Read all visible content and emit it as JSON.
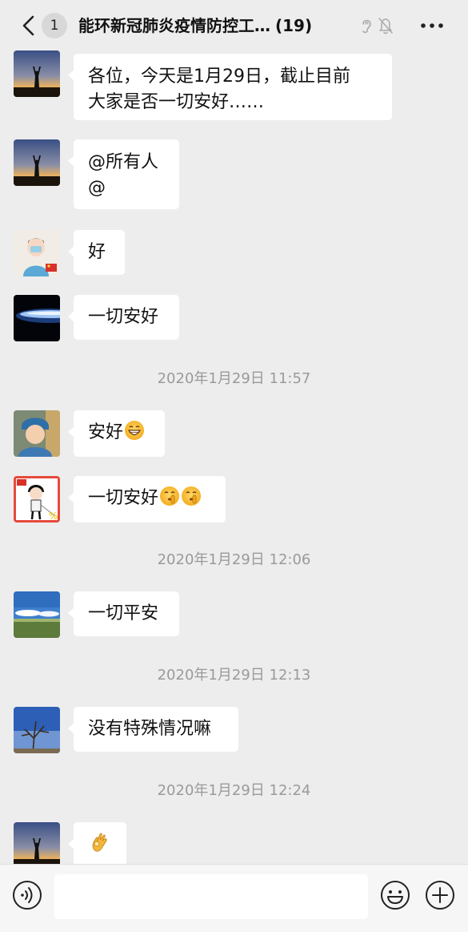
{
  "header": {
    "back_count": "1",
    "title": "能环新冠肺炎疫情防控工…",
    "member_count": "(19)",
    "icons": [
      "back-arrow-icon",
      "ear-icon",
      "bell-muted-icon",
      "more-icon"
    ]
  },
  "messages": [
    {
      "avatar": "sunset-silhouette-avatar",
      "lines": [
        "各位，今天是1月29日，截止目前",
        "大家是否一切安好……"
      ]
    },
    {
      "avatar": "sunset-silhouette-avatar",
      "lines": [
        "@所有人",
        "@"
      ]
    },
    {
      "avatar": "cartoon-doctor-avatar",
      "lines": [
        "好"
      ]
    },
    {
      "avatar": "earth-from-space-avatar",
      "lines": [
        "一切安好"
      ]
    },
    {
      "timestamp": "2020年1月29日 11:57"
    },
    {
      "avatar": "child-avatar",
      "lines": [
        "安好"
      ],
      "emoji": [
        "grin-emoji"
      ]
    },
    {
      "avatar": "cartoon-boy-avatar",
      "lines": [
        "一切安好"
      ],
      "emoji": [
        "shush-emoji",
        "shush-emoji"
      ]
    },
    {
      "timestamp": "2020年1月29日 12:06"
    },
    {
      "avatar": "sky-grassland-avatar",
      "lines": [
        "一切平安"
      ]
    },
    {
      "timestamp": "2020年1月29日 12:13"
    },
    {
      "avatar": "tree-sky-avatar",
      "lines": [
        "没有特殊情况嘛"
      ]
    },
    {
      "timestamp": "2020年1月29日 12:24"
    },
    {
      "avatar": "sunset-silhouette-avatar",
      "lines": [
        ""
      ],
      "emoji": [
        "ok-hand-emoji"
      ]
    }
  ],
  "input_bar": {
    "placeholder": "",
    "icons": [
      "voice-icon",
      "emoji-icon",
      "plus-icon"
    ]
  },
  "colors": {
    "background": "#ededed",
    "bubble": "#ffffff",
    "timestamp_text": "#9a9a9a"
  }
}
